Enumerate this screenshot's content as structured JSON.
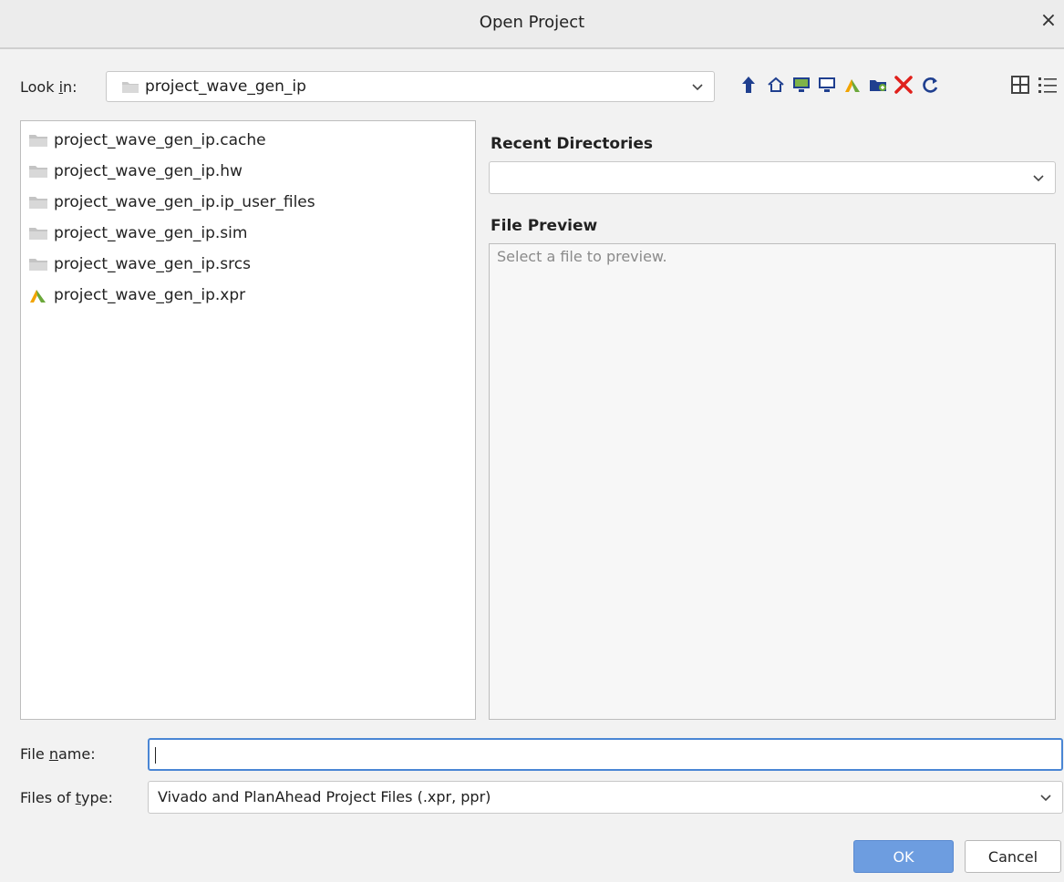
{
  "window": {
    "title": "Open Project",
    "close_glyph": "×"
  },
  "lookin": {
    "label_prefix": "Look ",
    "label_mnemonic": "i",
    "label_suffix": "n:",
    "value": "project_wave_gen_ip"
  },
  "toolbar": {
    "icons": [
      "up-folder-icon",
      "home-icon",
      "desktop-icon",
      "computer-icon",
      "vivado-icon",
      "new-folder-icon",
      "delete-icon",
      "refresh-icon",
      "list-view-icon",
      "details-view-icon"
    ]
  },
  "files": [
    {
      "name": "project_wave_gen_ip.cache",
      "type": "folder"
    },
    {
      "name": "project_wave_gen_ip.hw",
      "type": "folder"
    },
    {
      "name": "project_wave_gen_ip.ip_user_files",
      "type": "folder"
    },
    {
      "name": "project_wave_gen_ip.sim",
      "type": "folder"
    },
    {
      "name": "project_wave_gen_ip.srcs",
      "type": "folder"
    },
    {
      "name": "project_wave_gen_ip.xpr",
      "type": "project"
    }
  ],
  "recent": {
    "heading": "Recent Directories",
    "value": ""
  },
  "preview": {
    "heading": "File Preview",
    "placeholder": "Select a file to preview."
  },
  "filename": {
    "label_prefix": "File ",
    "label_mnemonic": "n",
    "label_suffix": "ame:",
    "value": ""
  },
  "filetype": {
    "label_prefix": "Files of ",
    "label_mnemonic": "t",
    "label_suffix": "ype:",
    "value": "Vivado and PlanAhead Project Files (.xpr, ppr)"
  },
  "buttons": {
    "ok": "OK",
    "cancel": "Cancel"
  },
  "colors": {
    "accent": "#4a86d4",
    "folder": "#c4c4c4",
    "delete": "#e0201b"
  }
}
